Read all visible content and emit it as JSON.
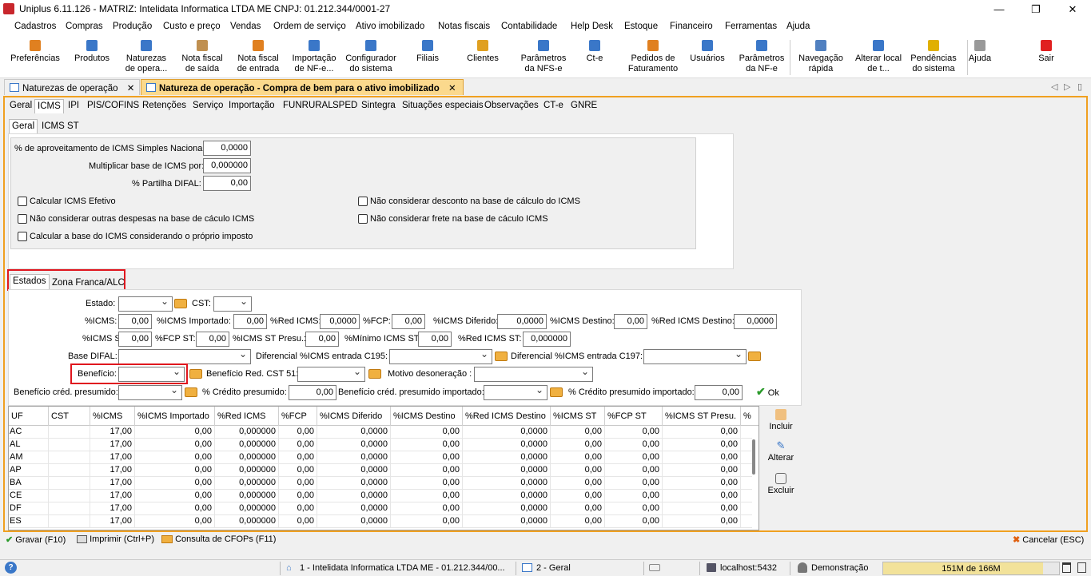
{
  "window": {
    "title": "Uniplus 6.11.126 - MATRIZ: Intelidata Informatica LTDA ME CNPJ: 01.212.344/0001-27",
    "min": "—",
    "max": "❐",
    "close": "✕"
  },
  "menu": [
    "Cadastros",
    "Compras",
    "Produção",
    "Custo e preço",
    "Vendas",
    "Ordem de serviço",
    "Ativo imobilizado",
    "Notas fiscais",
    "Contabilidade",
    "Help Desk",
    "Estoque",
    "Financeiro",
    "Ferramentas",
    "Ajuda"
  ],
  "toolbar": [
    {
      "label": "Preferências",
      "icon": "preferences-icon",
      "color": "#e08020"
    },
    {
      "label": "Produtos",
      "icon": "products-icon",
      "color": "#3a77c8"
    },
    {
      "label": "Naturezas\nde opera...",
      "icon": "natures-icon",
      "color": "#3a77c8"
    },
    {
      "label": "Nota fiscal\nde saída",
      "icon": "invoice-out-icon",
      "color": "#c09050"
    },
    {
      "label": "Nota fiscal\nde entrada",
      "icon": "invoice-in-icon",
      "color": "#e08020"
    },
    {
      "label": "Importação\nde NF-e...",
      "icon": "import-nfe-icon",
      "color": "#3a77c8"
    },
    {
      "label": "Configurador\ndo sistema",
      "icon": "configurator-icon",
      "color": "#3a77c8"
    },
    {
      "label": "Filiais",
      "icon": "branches-icon",
      "color": "#3a77c8"
    },
    {
      "label": "Clientes",
      "icon": "clients-icon",
      "color": "#e0a020"
    },
    {
      "label": "Parâmetros\nda NFS-e",
      "icon": "nfse-params-icon",
      "color": "#3a77c8"
    },
    {
      "label": "Ct-e",
      "icon": "cte-icon",
      "color": "#3a77c8"
    },
    {
      "label": "Pedidos de\nFaturamento",
      "icon": "orders-icon",
      "color": "#e08020"
    },
    {
      "label": "Usuários",
      "icon": "users-icon",
      "color": "#3a77c8"
    },
    {
      "label": "Parâmetros\nda NF-e",
      "icon": "nfe-params-icon",
      "color": "#3a77c8"
    },
    {
      "label": "Navegação\nrápida",
      "icon": "quick-nav-icon",
      "color": "#5080c0"
    },
    {
      "label": "Alterar local\nde t...",
      "icon": "home-icon",
      "color": "#3a77c8"
    },
    {
      "label": "Pendências\ndo sistema",
      "icon": "warning-icon",
      "color": "#e0b000"
    },
    {
      "label": "Ajuda",
      "icon": "help-icon",
      "color": "#999999"
    },
    {
      "label": "Sair",
      "icon": "power-icon",
      "color": "#e02020"
    }
  ],
  "doc_tabs": [
    {
      "label": "Naturezas de operação",
      "close": "✕"
    },
    {
      "label": "Natureza de operação - Compra de bem para o ativo imobilizado",
      "close": "✕"
    }
  ],
  "tabstrip_nav": {
    "prev": "◁",
    "next": "▷",
    "menu": "▯"
  },
  "main_tabs": [
    "Geral",
    "ICMS",
    "IPI",
    "PIS/COFINS",
    "Retenções",
    "Serviço",
    "Importação",
    "FUNRURAL",
    "SPED",
    "Sintegra",
    "Situações especiais",
    "Observações",
    "CT-e",
    "GNRE"
  ],
  "icms_tabs": [
    "Geral",
    "ICMS ST"
  ],
  "general": {
    "aproveitamento_label": "% de aproveitamento de ICMS Simples Nacional:",
    "aproveitamento_value": "0,0000",
    "multiplicar_label": "Multiplicar base de ICMS por:",
    "multiplicar_value": "0,000000",
    "partilha_label": "% Partilha DIFAL:",
    "partilha_value": "0,00",
    "checks": [
      "Calcular ICMS Efetivo",
      "Não considerar outras despesas na base de cáculo ICMS",
      "Calcular a base do ICMS considerando o próprio imposto",
      "Não considerar desconto na base de cálculo do ICMS",
      "Não considerar frete na base de cáculo ICMS"
    ]
  },
  "state_tabs": [
    "Estados",
    "Zona Franca/ALC"
  ],
  "form": {
    "estado": "Estado:",
    "cst": "CST:",
    "icms": "%ICMS:",
    "icms_v": "0,00",
    "icms_imp": "%ICMS Importado:",
    "icms_imp_v": "0,00",
    "red_icms": "%Red ICMS:",
    "red_icms_v": "0,0000",
    "fcp": "%FCP:",
    "fcp_v": "0,00",
    "icms_dif": "%ICMS Diferido:",
    "icms_dif_v": "0,0000",
    "icms_dest": "%ICMS Destino:",
    "icms_dest_v": "0,00",
    "red_icms_dest": "%Red ICMS Destino:",
    "red_icms_dest_v": "0,0000",
    "icms_st": "%ICMS ST:",
    "icms_st_v": "0,00",
    "fcp_st": "%FCP ST:",
    "fcp_st_v": "0,00",
    "icms_st_presu": "%ICMS ST Presu.:",
    "icms_st_presu_v": "0,00",
    "min_icms_st": "%Mínimo ICMS ST:",
    "min_icms_st_v": "0,00",
    "red_icms_st": "%Red ICMS ST:",
    "red_icms_st_v": "0,000000",
    "base_difal": "Base DIFAL:",
    "dif_c195": "Diferencial %ICMS entrada C195:",
    "dif_c197": "Diferencial %ICMS entrada C197:",
    "beneficio": "Benefício:",
    "beneficio_red": "Benefício Red. CST 51:",
    "motivo": "Motivo desoneração :",
    "ben_cred": "Benefício créd. presumido:",
    "credito": "% Crédito presumido:",
    "credito_v": "0,00",
    "ben_cred_imp": "Benefício créd. presumido importado:",
    "credito_imp": "% Crédito presumido importado:",
    "credito_imp_v": "0,00",
    "ok": "Ok"
  },
  "grid": {
    "columns": [
      "UF",
      "CST",
      "%ICMS",
      "%ICMS Importado",
      "%Red ICMS",
      "%FCP",
      "%ICMS Diferido",
      "%ICMS Destino",
      "%Red ICMS Destino",
      "%ICMS ST",
      "%FCP ST",
      "%ICMS ST Presu.",
      "%"
    ],
    "rows": [
      [
        "AC",
        "",
        "17,00",
        "0,00",
        "0,000000",
        "0,00",
        "0,0000",
        "0,00",
        "0,0000",
        "0,00",
        "0,00",
        "0,00"
      ],
      [
        "AL",
        "",
        "17,00",
        "0,00",
        "0,000000",
        "0,00",
        "0,0000",
        "0,00",
        "0,0000",
        "0,00",
        "0,00",
        "0,00"
      ],
      [
        "AM",
        "",
        "17,00",
        "0,00",
        "0,000000",
        "0,00",
        "0,0000",
        "0,00",
        "0,0000",
        "0,00",
        "0,00",
        "0,00"
      ],
      [
        "AP",
        "",
        "17,00",
        "0,00",
        "0,000000",
        "0,00",
        "0,0000",
        "0,00",
        "0,0000",
        "0,00",
        "0,00",
        "0,00"
      ],
      [
        "BA",
        "",
        "17,00",
        "0,00",
        "0,000000",
        "0,00",
        "0,0000",
        "0,00",
        "0,0000",
        "0,00",
        "0,00",
        "0,00"
      ],
      [
        "CE",
        "",
        "17,00",
        "0,00",
        "0,000000",
        "0,00",
        "0,0000",
        "0,00",
        "0,0000",
        "0,00",
        "0,00",
        "0,00"
      ],
      [
        "DF",
        "",
        "17,00",
        "0,00",
        "0,000000",
        "0,00",
        "0,0000",
        "0,00",
        "0,0000",
        "0,00",
        "0,00",
        "0,00"
      ],
      [
        "ES",
        "",
        "17,00",
        "0,00",
        "0,000000",
        "0,00",
        "0,0000",
        "0,00",
        "0,0000",
        "0,00",
        "0,00",
        "0,00"
      ]
    ]
  },
  "side_actions": [
    "Incluir",
    "Alterar",
    "Excluir"
  ],
  "bottom": {
    "gravar": "Gravar (F10)",
    "imprimir": "Imprimir (Ctrl+P)",
    "cfops": "Consulta de CFOPs (F11)",
    "cancelar": "Cancelar (ESC)"
  },
  "status": {
    "help": "?",
    "company": "1 - Intelidata Informatica LTDA ME - 01.212.344/00...",
    "mode": "2 - Geral",
    "host": "localhost:5432",
    "user": "Demonstração",
    "memory": "151M de 166M"
  },
  "colors": {
    "accent_orange": "#f0a020",
    "active_tab": "#fbd98d",
    "highlight_red": "#e0161e",
    "memory_bar": "#f2e29a"
  }
}
